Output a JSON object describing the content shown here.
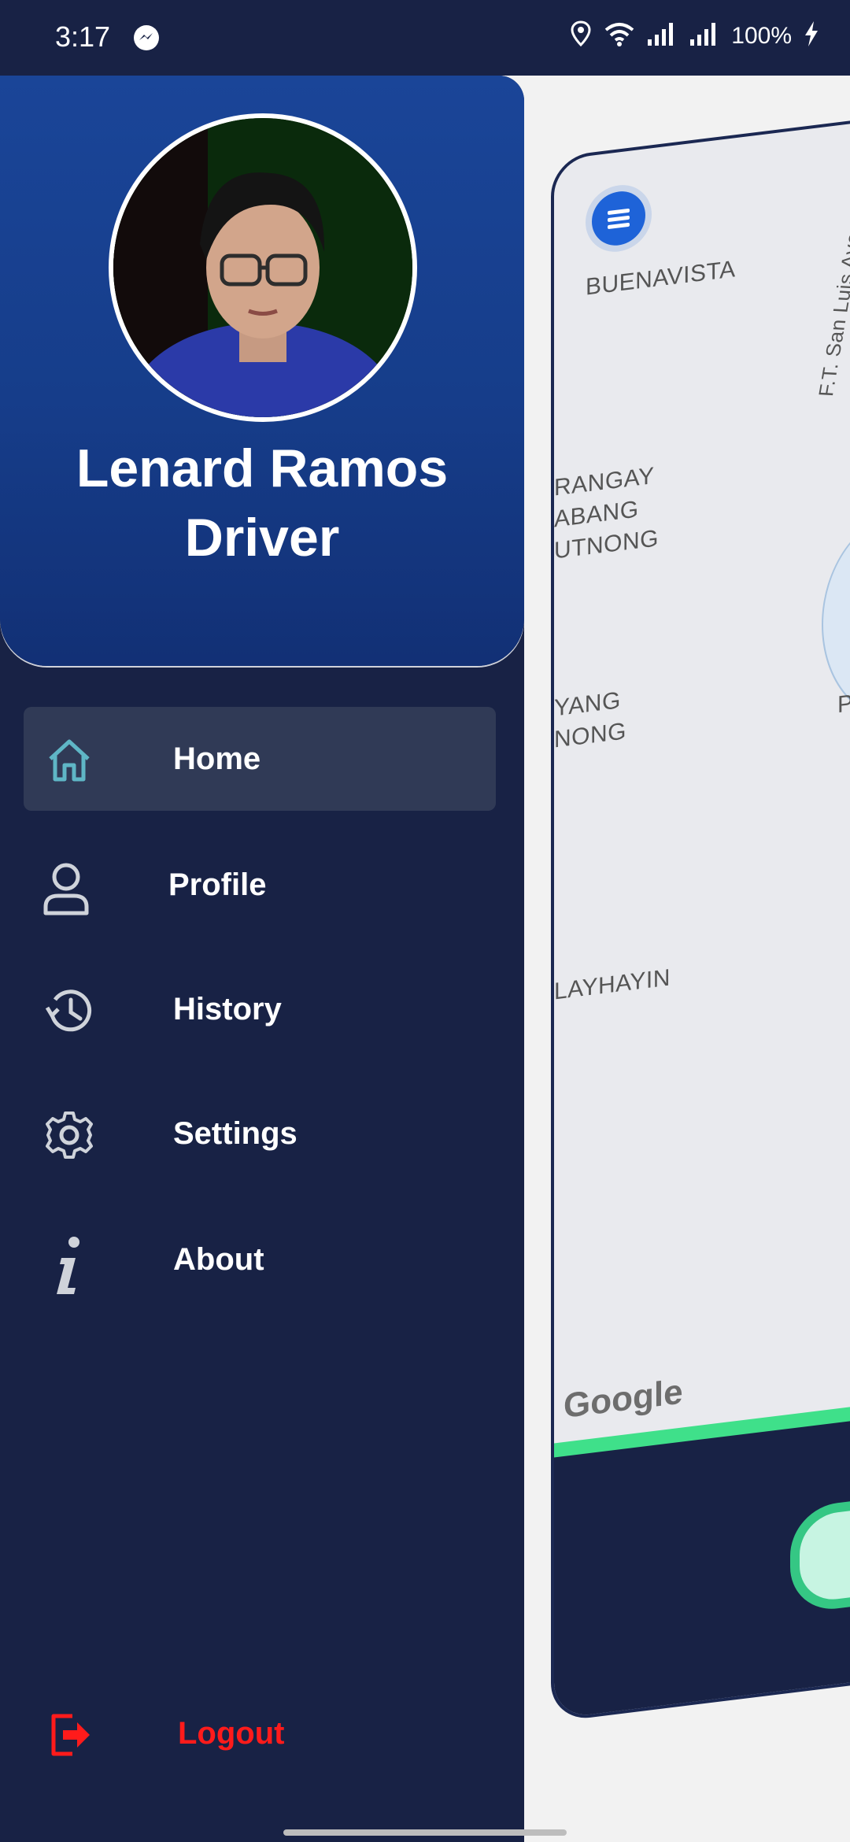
{
  "status_bar": {
    "time": "3:17",
    "battery": "100%",
    "icons": [
      "messenger-icon",
      "location-icon",
      "wifi-icon",
      "signal-icon",
      "signal-icon",
      "charging-icon"
    ]
  },
  "drawer": {
    "user_name": "Lenard Ramos",
    "user_role": "Driver",
    "menu": [
      {
        "label": "Home",
        "icon": "home-icon",
        "active": true
      },
      {
        "label": "Profile",
        "icon": "user-icon",
        "active": false
      },
      {
        "label": "History",
        "icon": "history-icon",
        "active": false
      },
      {
        "label": "Settings",
        "icon": "gear-icon",
        "active": false
      },
      {
        "label": "About",
        "icon": "info-icon",
        "active": false
      }
    ],
    "logout_label": "Logout",
    "colors": {
      "drawer_bg": "#182245",
      "header": "#1a4598",
      "active_item": "#303a56",
      "logout": "#ff1b1b",
      "home_icon": "#5fb6c6"
    }
  },
  "map": {
    "labels": [
      "BUENAVISTA",
      "F.T. San Luis Ave",
      "RANGAY",
      "ABANG",
      "UTNONG",
      "YANG",
      "NONG",
      "LAYHAYIN",
      "P"
    ],
    "brand": "Google",
    "colors": {
      "progress": "#3fe08a",
      "pill": "#c7f4e2",
      "fab": "#1e63d8"
    }
  }
}
